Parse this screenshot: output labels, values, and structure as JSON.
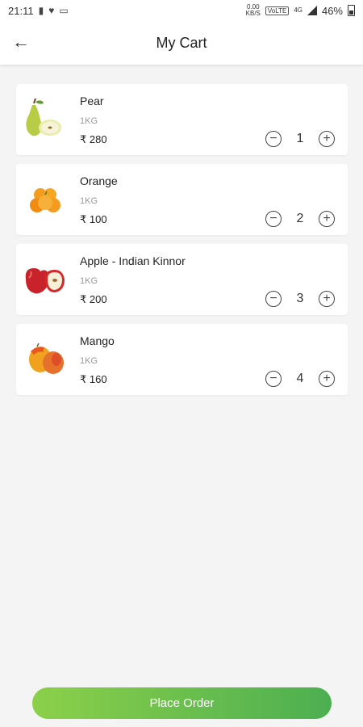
{
  "status_bar": {
    "time": "21:11",
    "net_speed_top": "0.00",
    "net_speed_bottom": "KB/S",
    "volte": "VoLTE",
    "network_type": "4G",
    "battery": "46%",
    "icons": [
      "sim-icon",
      "heart-icon",
      "laptop-icon",
      "signal-icon",
      "battery-icon"
    ]
  },
  "header": {
    "back_icon": "←",
    "title": "My Cart"
  },
  "cart": {
    "currency": "₹",
    "items": [
      {
        "name": "Pear",
        "unit": "1KG",
        "price": "₹ 280",
        "qty": "1",
        "image": "pear"
      },
      {
        "name": "Orange",
        "unit": "1KG",
        "price": "₹ 100",
        "qty": "2",
        "image": "orange"
      },
      {
        "name": "Apple - Indian Kinnor",
        "unit": "1KG",
        "price": "₹ 200",
        "qty": "3",
        "image": "apple"
      },
      {
        "name": "Mango",
        "unit": "1KG",
        "price": "₹ 160",
        "qty": "4",
        "image": "mango"
      }
    ],
    "minus_symbol": "−",
    "plus_symbol": "+"
  },
  "footer": {
    "place_order_label": "Place Order"
  },
  "colors": {
    "button_start": "#8cd04a",
    "button_end": "#4caf50",
    "background": "#f4f4f4"
  }
}
